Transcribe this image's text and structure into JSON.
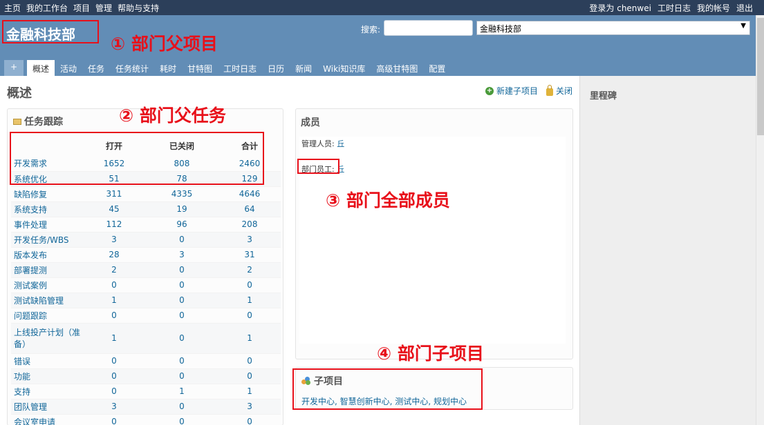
{
  "topnav": {
    "left": [
      "主页",
      "我的工作台",
      "项目",
      "管理",
      "帮助与支持"
    ],
    "logged_in": "登录为 chenwei",
    "right": [
      "工时日志",
      "我的帐号",
      "退出"
    ]
  },
  "header": {
    "project_title": "金融科技部",
    "search_label": "搜索:",
    "search_value": "",
    "project_jump": "金融科技部"
  },
  "tabs": [
    "概述",
    "活动",
    "任务",
    "任务统计",
    "耗时",
    "甘特图",
    "工时日志",
    "日历",
    "新闻",
    "Wiki知识库",
    "高级甘特图",
    "配置"
  ],
  "tab_plus": "+",
  "annotations": {
    "a1": "① 部门父项目",
    "a2": "② 部门父任务",
    "a3": "③ 部门全部成员",
    "a4": "④ 部门子项目"
  },
  "page": {
    "title": "概述",
    "new_subproject": "新建子项目",
    "close": "关闭"
  },
  "sidebar": {
    "title": "里程碑"
  },
  "issues": {
    "title": "任务跟踪",
    "headers": [
      "",
      "打开",
      "已关闭",
      "合计"
    ],
    "rows": [
      [
        "开发需求",
        "1652",
        "808",
        "2460"
      ],
      [
        "系统优化",
        "51",
        "78",
        "129"
      ],
      [
        "缺陷修复",
        "311",
        "4335",
        "4646"
      ],
      [
        "系统支持",
        "45",
        "19",
        "64"
      ],
      [
        "事件处理",
        "112",
        "96",
        "208"
      ],
      [
        "开发任务/WBS",
        "3",
        "0",
        "3"
      ],
      [
        "版本发布",
        "28",
        "3",
        "31"
      ],
      [
        "部署提测",
        "2",
        "0",
        "2"
      ],
      [
        "测试案例",
        "0",
        "0",
        "0"
      ],
      [
        "测试缺陷管理",
        "1",
        "0",
        "1"
      ],
      [
        "问题跟踪",
        "0",
        "0",
        "0"
      ],
      [
        "上线投产计划（准备）",
        "1",
        "0",
        "1"
      ],
      [
        "错误",
        "0",
        "0",
        "0"
      ],
      [
        "功能",
        "0",
        "0",
        "0"
      ],
      [
        "支持",
        "0",
        "1",
        "1"
      ],
      [
        "团队管理",
        "3",
        "0",
        "3"
      ],
      [
        "会议室申请",
        "0",
        "0",
        "0"
      ]
    ]
  },
  "members": {
    "title": "成员",
    "manager_label": "管理人员:",
    "manager_value": "丘",
    "staff_label": "部门员工:",
    "staff_value": "丘"
  },
  "subprojects": {
    "title": "子项目",
    "links": [
      "开发中心",
      "智慧创新中心",
      "测试中心",
      "规划中心"
    ]
  }
}
